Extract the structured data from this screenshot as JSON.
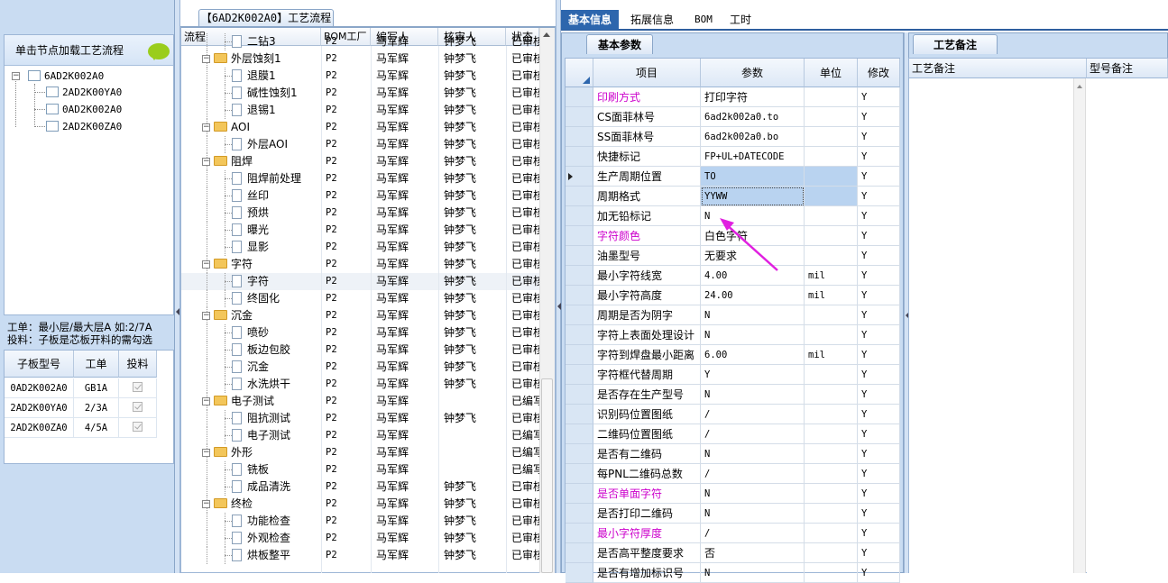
{
  "left": {
    "hint": "单击节点加载工艺流程",
    "tree_root": "6AD2K002A0",
    "tree_children": [
      "2AD2K00YA0",
      "0AD2K002A0",
      "2AD2K00ZA0"
    ],
    "note_line1": "工单：最小层/最大层A 如:2/7A",
    "note_line2": "投料：子板是芯板开料的需勾选",
    "sub_headers": [
      "子板型号",
      "工单",
      "投料"
    ],
    "sub_rows": [
      {
        "model": "0AD2K002A0",
        "order": "GB1A"
      },
      {
        "model": "2AD2K00YA0",
        "order": "2/3A"
      },
      {
        "model": "2AD2K00ZA0",
        "order": "4/5A"
      }
    ]
  },
  "middle": {
    "title": "【6AD2K002A0】工艺流程",
    "headers": [
      "流程",
      "BOM工厂",
      "编写人",
      "核审人",
      "状态"
    ],
    "rows": [
      {
        "name": "二钻3",
        "type": "leaf",
        "bom": "P2",
        "writer": "马军辉",
        "reviewer": "钟梦飞",
        "status": "已审核"
      },
      {
        "name": "外层蚀刻1",
        "type": "folder",
        "bom": "P2",
        "writer": "马军辉",
        "reviewer": "钟梦飞",
        "status": "已审核"
      },
      {
        "name": "退膜1",
        "type": "leaf",
        "bom": "P2",
        "writer": "马军辉",
        "reviewer": "钟梦飞",
        "status": "已审核"
      },
      {
        "name": "碱性蚀刻1",
        "type": "leaf",
        "bom": "P2",
        "writer": "马军辉",
        "reviewer": "钟梦飞",
        "status": "已审核"
      },
      {
        "name": "退锡1",
        "type": "leaf",
        "bom": "P2",
        "writer": "马军辉",
        "reviewer": "钟梦飞",
        "status": "已审核"
      },
      {
        "name": "AOI",
        "type": "folder",
        "bom": "P2",
        "writer": "马军辉",
        "reviewer": "钟梦飞",
        "status": "已审核"
      },
      {
        "name": "外层AOI",
        "type": "leaf",
        "bom": "P2",
        "writer": "马军辉",
        "reviewer": "钟梦飞",
        "status": "已审核"
      },
      {
        "name": "阻焊",
        "type": "folder",
        "bom": "P2",
        "writer": "马军辉",
        "reviewer": "钟梦飞",
        "status": "已审核"
      },
      {
        "name": "阻焊前处理",
        "type": "leaf",
        "bom": "P2",
        "writer": "马军辉",
        "reviewer": "钟梦飞",
        "status": "已审核"
      },
      {
        "name": "丝印",
        "type": "leaf",
        "bom": "P2",
        "writer": "马军辉",
        "reviewer": "钟梦飞",
        "status": "已审核"
      },
      {
        "name": "预烘",
        "type": "leaf",
        "bom": "P2",
        "writer": "马军辉",
        "reviewer": "钟梦飞",
        "status": "已审核"
      },
      {
        "name": "曝光",
        "type": "leaf",
        "bom": "P2",
        "writer": "马军辉",
        "reviewer": "钟梦飞",
        "status": "已审核"
      },
      {
        "name": "显影",
        "type": "leaf",
        "bom": "P2",
        "writer": "马军辉",
        "reviewer": "钟梦飞",
        "status": "已审核"
      },
      {
        "name": "字符",
        "type": "folder",
        "bom": "P2",
        "writer": "马军辉",
        "reviewer": "钟梦飞",
        "status": "已审核"
      },
      {
        "name": "字符",
        "type": "leaf",
        "bom": "P2",
        "writer": "马军辉",
        "reviewer": "钟梦飞",
        "status": "已审核",
        "selected": true
      },
      {
        "name": "终固化",
        "type": "leaf",
        "bom": "P2",
        "writer": "马军辉",
        "reviewer": "钟梦飞",
        "status": "已审核"
      },
      {
        "name": "沉金",
        "type": "folder",
        "bom": "P2",
        "writer": "马军辉",
        "reviewer": "钟梦飞",
        "status": "已审核"
      },
      {
        "name": "喷砂",
        "type": "leaf",
        "bom": "P2",
        "writer": "马军辉",
        "reviewer": "钟梦飞",
        "status": "已审核"
      },
      {
        "name": "板边包胶",
        "type": "leaf",
        "bom": "P2",
        "writer": "马军辉",
        "reviewer": "钟梦飞",
        "status": "已审核"
      },
      {
        "name": "沉金",
        "type": "leaf",
        "bom": "P2",
        "writer": "马军辉",
        "reviewer": "钟梦飞",
        "status": "已审核"
      },
      {
        "name": "水洗烘干",
        "type": "leaf",
        "bom": "P2",
        "writer": "马军辉",
        "reviewer": "钟梦飞",
        "status": "已审核"
      },
      {
        "name": "电子测试",
        "type": "folder",
        "bom": "P2",
        "writer": "马军辉",
        "reviewer": "",
        "status": "已编写"
      },
      {
        "name": "阻抗测试",
        "type": "leaf",
        "bom": "P2",
        "writer": "马军辉",
        "reviewer": "钟梦飞",
        "status": "已审核"
      },
      {
        "name": "电子测试",
        "type": "leaf",
        "bom": "P2",
        "writer": "马军辉",
        "reviewer": "",
        "status": "已编写"
      },
      {
        "name": "外形",
        "type": "folder",
        "bom": "P2",
        "writer": "马军辉",
        "reviewer": "",
        "status": "已编写"
      },
      {
        "name": "铣板",
        "type": "leaf",
        "bom": "P2",
        "writer": "马军辉",
        "reviewer": "",
        "status": "已编写"
      },
      {
        "name": "成品清洗",
        "type": "leaf",
        "bom": "P2",
        "writer": "马军辉",
        "reviewer": "钟梦飞",
        "status": "已审核"
      },
      {
        "name": "终检",
        "type": "folder",
        "bom": "P2",
        "writer": "马军辉",
        "reviewer": "钟梦飞",
        "status": "已审核"
      },
      {
        "name": "功能检查",
        "type": "leaf",
        "bom": "P2",
        "writer": "马军辉",
        "reviewer": "钟梦飞",
        "status": "已审核"
      },
      {
        "name": "外观检查",
        "type": "leaf",
        "bom": "P2",
        "writer": "马军辉",
        "reviewer": "钟梦飞",
        "status": "已审核"
      },
      {
        "name": "烘板整平",
        "type": "leaf",
        "bom": "P2",
        "writer": "马军辉",
        "reviewer": "钟梦飞",
        "status": "已审核"
      }
    ]
  },
  "right": {
    "tabs": [
      "基本信息",
      "拓展信息",
      "BOM",
      "工时"
    ],
    "params_tab": "基本参数",
    "remark_tab": "工艺备注",
    "param_headers": [
      "项目",
      "参数",
      "单位",
      "修改"
    ],
    "remark_headers": [
      "工艺备注",
      "型号备注"
    ],
    "params": [
      {
        "item": "印刷方式",
        "value": "打印字符",
        "unit": "",
        "mod": "Y",
        "pink": true
      },
      {
        "item": "CS面菲林号",
        "value": "6ad2k002a0.to",
        "unit": "",
        "mod": "Y",
        "mono": true
      },
      {
        "item": "SS面菲林号",
        "value": "6ad2k002a0.bo",
        "unit": "",
        "mod": "Y",
        "mono": true
      },
      {
        "item": "快捷标记",
        "value": "FP+UL+DATECODE",
        "unit": "",
        "mod": "Y",
        "mono": true
      },
      {
        "item": "生产周期位置",
        "value": "TO",
        "unit": "",
        "mod": "Y",
        "mono": true,
        "hl": true,
        "current": true
      },
      {
        "item": "周期格式",
        "value": "YYWW",
        "unit": "",
        "mod": "Y",
        "mono": true,
        "hl": true,
        "editing": true
      },
      {
        "item": "加无铅标记",
        "value": "N",
        "unit": "",
        "mod": "Y",
        "mono": true
      },
      {
        "item": "字符颜色",
        "value": "白色字符",
        "unit": "",
        "mod": "Y",
        "pink": true
      },
      {
        "item": "油墨型号",
        "value": "无要求",
        "unit": "",
        "mod": "Y"
      },
      {
        "item": "最小字符线宽",
        "value": "4.00",
        "unit": "mil",
        "mod": "Y",
        "mono": true
      },
      {
        "item": "最小字符高度",
        "value": "24.00",
        "unit": "mil",
        "mod": "Y",
        "mono": true
      },
      {
        "item": "周期是否为阴字",
        "value": "N",
        "unit": "",
        "mod": "Y",
        "mono": true
      },
      {
        "item": "字符上表面处理设计",
        "value": "N",
        "unit": "",
        "mod": "Y",
        "mono": true
      },
      {
        "item": "字符到焊盘最小距离",
        "value": "6.00",
        "unit": "mil",
        "mod": "Y",
        "mono": true
      },
      {
        "item": "字符框代替周期",
        "value": "Y",
        "unit": "",
        "mod": "Y",
        "mono": true
      },
      {
        "item": "是否存在生产型号",
        "value": "N",
        "unit": "",
        "mod": "Y",
        "mono": true
      },
      {
        "item": "识别码位置图纸",
        "value": "/",
        "unit": "",
        "mod": "Y",
        "mono": true
      },
      {
        "item": "二维码位置图纸",
        "value": "/",
        "unit": "",
        "mod": "Y",
        "mono": true
      },
      {
        "item": "是否有二维码",
        "value": "N",
        "unit": "",
        "mod": "Y",
        "mono": true
      },
      {
        "item": "每PNL二维码总数",
        "value": "/",
        "unit": "",
        "mod": "Y",
        "mono": true
      },
      {
        "item": "是否单面字符",
        "value": "N",
        "unit": "",
        "mod": "Y",
        "mono": true,
        "pink": true
      },
      {
        "item": "是否打印二维码",
        "value": "N",
        "unit": "",
        "mod": "Y",
        "mono": true
      },
      {
        "item": "最小字符厚度",
        "value": "/",
        "unit": "",
        "mod": "Y",
        "mono": true,
        "pink": true
      },
      {
        "item": "是否高平整度要求",
        "value": "否",
        "unit": "",
        "mod": "Y"
      },
      {
        "item": "是否有增加标识号",
        "value": "N",
        "unit": "",
        "mod": "Y",
        "mono": true
      }
    ]
  },
  "colors": {
    "pink": "#cc00cc",
    "tab_active": "#2d66ad",
    "arrow": "#e020e0",
    "highlight": "#b9d3f0"
  }
}
